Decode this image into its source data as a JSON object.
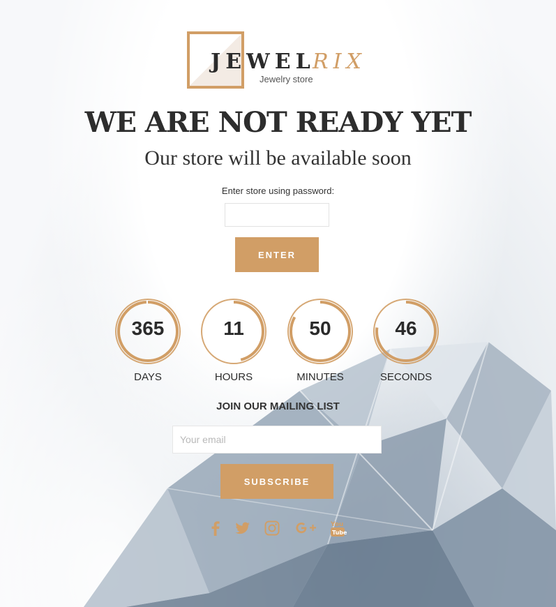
{
  "brand": {
    "name_part1": "JEWEL",
    "name_part2": "RIX",
    "tagline": "Jewelry store",
    "accent_color": "#d19e66"
  },
  "hero": {
    "title": "WE ARE NOT READY YET",
    "subtitle": "Our store will be available soon"
  },
  "password": {
    "label": "Enter store using password:",
    "value": "",
    "button_label": "ENTER"
  },
  "countdown": {
    "days": {
      "value": "365",
      "label": "DAYS",
      "progress": 0.99
    },
    "hours": {
      "value": "11",
      "label": "HOURS",
      "progress": 0.46
    },
    "minutes": {
      "value": "50",
      "label": "MINUTES",
      "progress": 0.83
    },
    "seconds": {
      "value": "46",
      "label": "SECONDS",
      "progress": 0.77
    }
  },
  "mailing": {
    "title": "JOIN OUR MAILING LIST",
    "email_placeholder": "Your email",
    "button_label": "SUBSCRIBE"
  },
  "social_icons": [
    "facebook-icon",
    "twitter-icon",
    "instagram-icon",
    "google-plus-icon",
    "youtube-icon"
  ]
}
